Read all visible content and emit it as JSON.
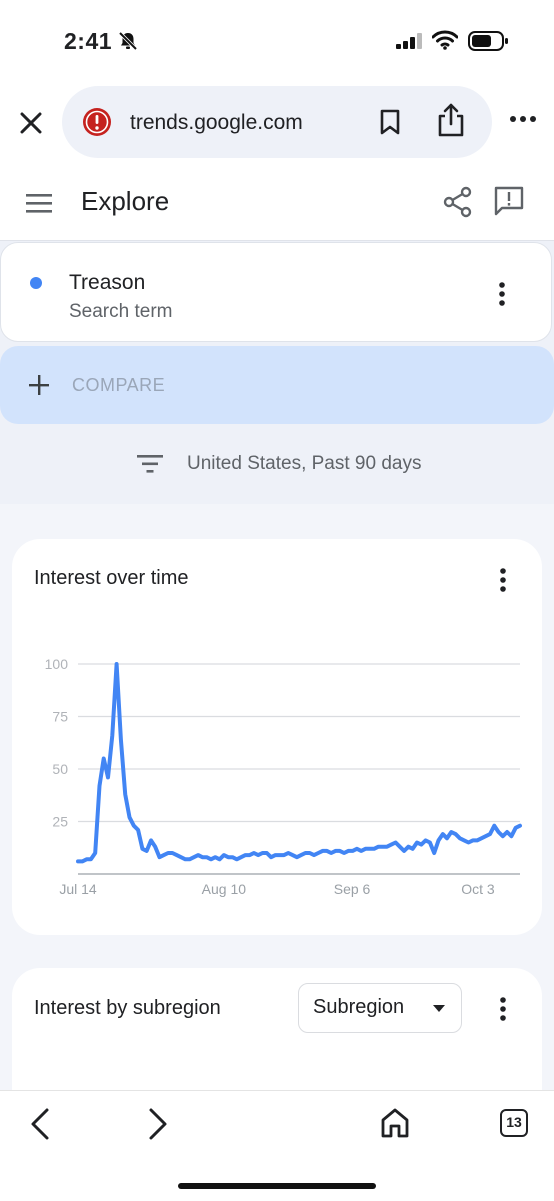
{
  "status_bar": {
    "time": "2:41"
  },
  "browser": {
    "url": "trends.google.com"
  },
  "header": {
    "title": "Explore"
  },
  "search_term": {
    "name": "Treason",
    "subtitle": "Search term",
    "color": "#4285f4"
  },
  "compare": {
    "label": "COMPARE"
  },
  "filter": {
    "text": "United States, Past 90 days"
  },
  "interest_over_time": {
    "title": "Interest over time",
    "chart_data": {
      "type": "line",
      "title": "",
      "xlabel": "",
      "ylabel": "",
      "ylim": [
        0,
        100
      ],
      "yticks": [
        100,
        75,
        50,
        25
      ],
      "xtick_labels": [
        "Jul 14",
        "Aug 10",
        "Sep 6",
        "Oct 3"
      ],
      "grid": true,
      "series": [
        {
          "color": "#4285f4",
          "values": [
            6,
            6,
            7,
            7,
            10,
            42,
            55,
            46,
            66,
            100,
            64,
            38,
            27,
            23,
            21,
            12,
            11,
            16,
            13,
            8,
            9,
            10,
            10,
            9,
            8,
            7,
            7,
            8,
            9,
            8,
            8,
            7,
            8,
            7,
            9,
            8,
            8,
            7,
            8,
            9,
            9,
            10,
            9,
            10,
            10,
            8,
            9,
            9,
            9,
            10,
            9,
            8,
            9,
            10,
            10,
            9,
            10,
            11,
            11,
            10,
            11,
            11,
            10,
            11,
            11,
            12,
            11,
            12,
            12,
            12,
            13,
            13,
            13,
            14,
            15,
            13,
            11,
            13,
            12,
            15,
            14,
            16,
            15,
            10,
            16,
            19,
            17,
            20,
            19,
            17,
            16,
            15,
            16,
            16,
            17,
            18,
            19,
            23,
            20,
            18,
            20,
            18,
            22,
            23
          ]
        }
      ]
    }
  },
  "interest_by_subregion": {
    "title": "Interest by subregion",
    "dropdown_value": "Subregion"
  },
  "tabs_count": "13"
}
